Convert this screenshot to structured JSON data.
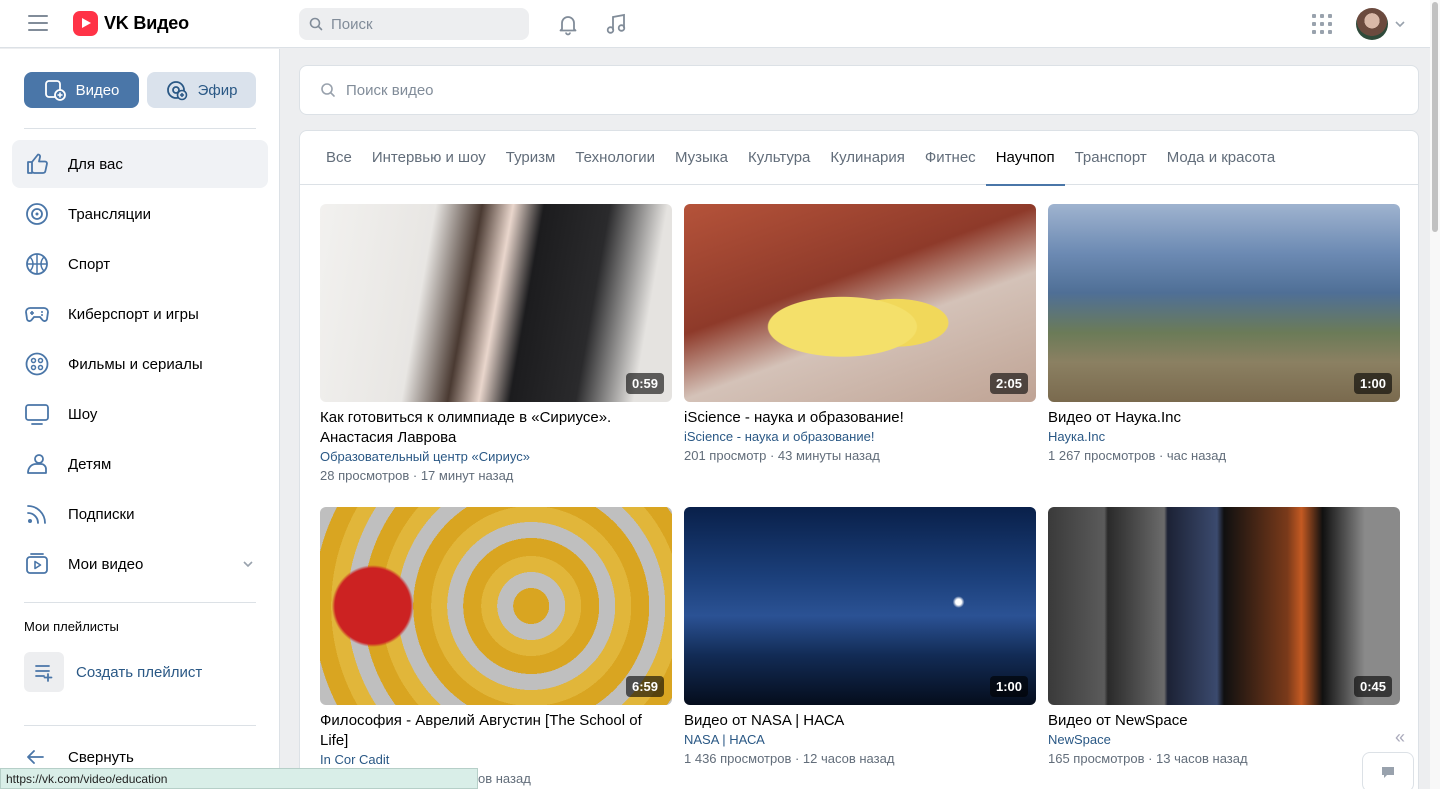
{
  "header": {
    "logo_text": "VK Видео",
    "search_placeholder": "Поиск"
  },
  "sidebar": {
    "video_button": "Видео",
    "live_button": "Эфир",
    "items": [
      {
        "label": "Для вас",
        "icon": "thumbs-up-icon",
        "active": true
      },
      {
        "label": "Трансляции",
        "icon": "broadcast-icon"
      },
      {
        "label": "Спорт",
        "icon": "ball-icon"
      },
      {
        "label": "Киберспорт и игры",
        "icon": "gamepad-icon"
      },
      {
        "label": "Фильмы и сериалы",
        "icon": "film-reel-icon"
      },
      {
        "label": "Шоу",
        "icon": "tv-icon"
      },
      {
        "label": "Детям",
        "icon": "kids-icon"
      },
      {
        "label": "Подписки",
        "icon": "rss-icon"
      },
      {
        "label": "Мои видео",
        "icon": "my-video-icon"
      }
    ],
    "playlists_title": "Мои плейлисты",
    "create_playlist": "Создать плейлист",
    "collapse": "Свернуть"
  },
  "main": {
    "search_placeholder": "Поиск видео",
    "tabs": [
      "Все",
      "Интервью и шоу",
      "Туризм",
      "Технологии",
      "Музыка",
      "Культура",
      "Кулинария",
      "Фитнес",
      "Научпоп",
      "Транспорт",
      "Мода и красота"
    ],
    "active_tab": "Научпоп",
    "videos": [
      {
        "title": "Как готовиться к олимпиаде в «Сириусе». Анастасия Лаврова",
        "channel": "Образовательный центр «Сириус»",
        "meta": "28 просмотров · 17 минут назад",
        "duration": "0:59"
      },
      {
        "title": "iScience - наука и образование!",
        "channel": "iScience - наука и образование!",
        "meta": "201 просмотр · 43 минуты назад",
        "duration": "2:05"
      },
      {
        "title": "Видео от Наука.Inc",
        "channel": "Наука.Inc",
        "meta": "1 267 просмотров · час назад",
        "duration": "1:00"
      },
      {
        "title": "Философия - Аврелий Августин [The School of Life]",
        "channel": "In Cor Cadit",
        "meta": "ов назад",
        "duration": "6:59"
      },
      {
        "title": "Видео от NASA | НАСА",
        "channel": "NASA | НАСА",
        "meta": "1 436 просмотров · 12 часов назад",
        "duration": "1:00"
      },
      {
        "title": "Видео от NewSpace",
        "channel": "NewSpace",
        "meta": "165 просмотров · 13 часов назад",
        "duration": "0:45"
      }
    ]
  },
  "status_url": "https://vk.com/video/education"
}
